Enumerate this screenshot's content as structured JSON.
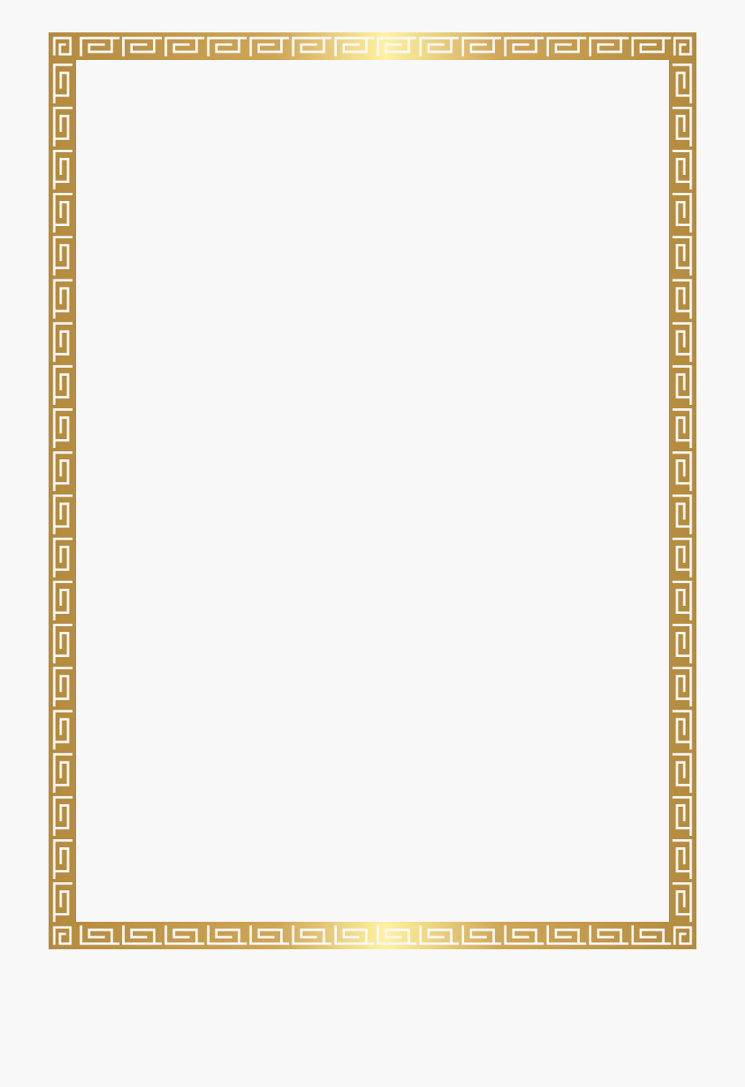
{
  "background_color": "#f8f8f8",
  "frame": {
    "style": "greek-key-meander-border",
    "colors": {
      "gold_dark": "#b38a3e",
      "gold_mid": "#cfa556",
      "gold_light": "#fff2a0",
      "interior": "#f8f8f8"
    }
  }
}
